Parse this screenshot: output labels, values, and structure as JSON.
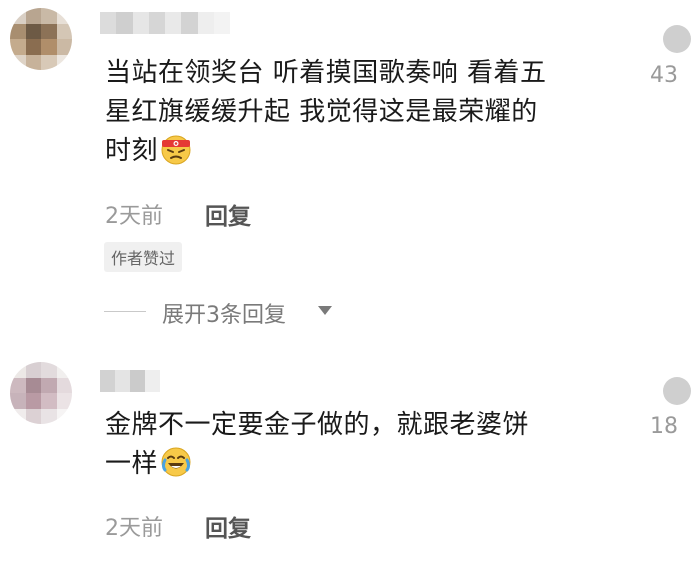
{
  "comments": [
    {
      "text_lines": [
        "当站在领奖台 听着摸国歌奏响 看着五",
        "星红旗缓缓升起 我觉得这是最荣耀的",
        "时刻"
      ],
      "emoji": "angry-headband-emoji",
      "time": "2天前",
      "reply_label": "回复",
      "author_tag": "作者赞过",
      "expand_label": "展开3条回复",
      "like_count": "43"
    },
    {
      "text_lines": [
        "金牌不一定要金子做的，就跟老婆饼",
        "一样"
      ],
      "emoji": "rolling-laughing-emoji",
      "time": "2天前",
      "reply_label": "回复",
      "like_count": "18"
    }
  ],
  "colors": {
    "text": "#1a1a1a",
    "meta": "#9a9a9a",
    "tag_bg": "#f0f0f0"
  }
}
